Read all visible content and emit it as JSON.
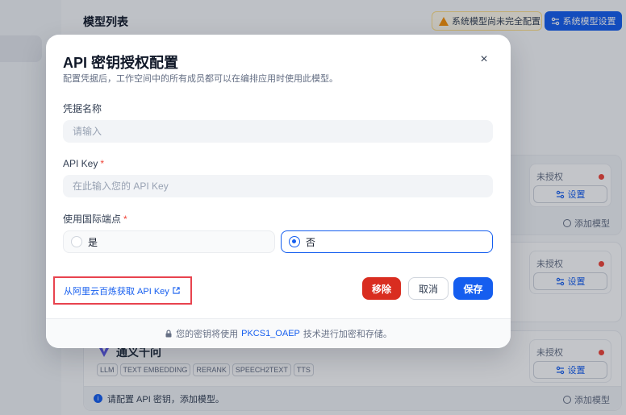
{
  "background": {
    "title": "模型列表",
    "warning_badge": "系统模型尚未完全配置",
    "system_model_button": "系统模型设置",
    "cards": [
      {
        "auth_status": "未授权",
        "setup_label": "设置",
        "add_model": "添加模型"
      },
      {
        "auth_status": "未授权",
        "setup_label": "设置"
      },
      {
        "provider_name": "通义千问",
        "auth_status": "未授权",
        "setup_label": "设置",
        "tags": [
          "LLM",
          "TEXT EMBEDDING",
          "RERANK",
          "SPEECH2TEXT",
          "TTS"
        ],
        "footer_note": "请配置 API 密钥，添加模型。",
        "add_model": "添加模型"
      }
    ]
  },
  "modal": {
    "title": "API 密钥授权配置",
    "description": "配置凭据后，工作空间中的所有成员都可以在编排应用时使用此模型。",
    "fields": {
      "credential_name": {
        "label": "凭据名称",
        "placeholder": "请输入",
        "value": ""
      },
      "api_key": {
        "label": "API Key",
        "required": "*",
        "placeholder": "在此输入您的 API Key",
        "value": ""
      },
      "intl_endpoint": {
        "label": "使用国际端点",
        "required": "*",
        "options": [
          {
            "label": "是",
            "selected": false
          },
          {
            "label": "否",
            "selected": true
          }
        ]
      }
    },
    "get_key_link": "从阿里云百炼获取 API Key",
    "buttons": {
      "remove": "移除",
      "cancel": "取消",
      "save": "保存"
    },
    "footer": {
      "prefix": "您的密钥将使用",
      "link": "PKCS1_OAEP",
      "suffix": "技术进行加密和存储。"
    }
  },
  "colors": {
    "primary": "#155eef",
    "danger": "#d92d20",
    "highlight_box": "#e8434e",
    "warning": "#f79009"
  }
}
